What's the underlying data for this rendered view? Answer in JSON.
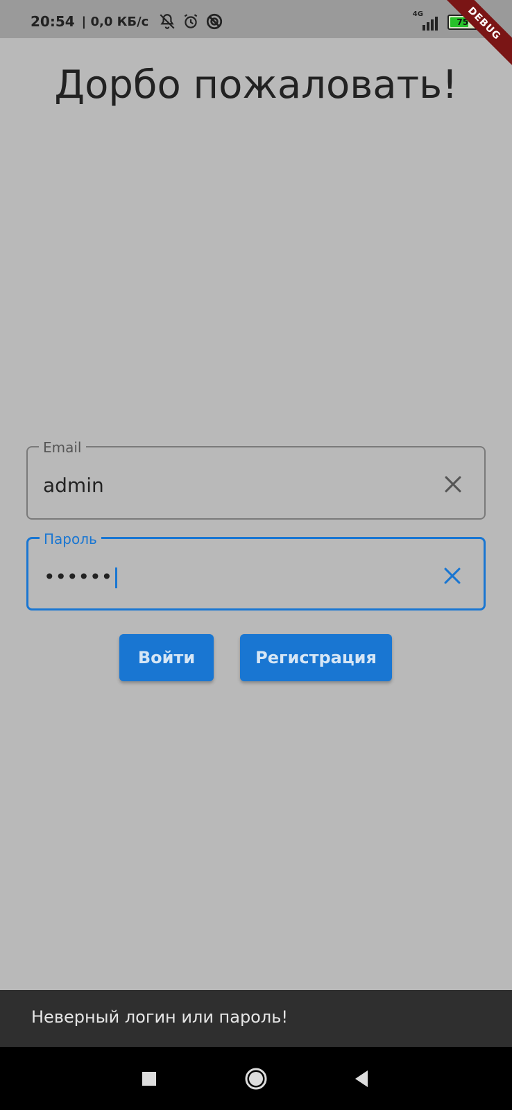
{
  "status_bar": {
    "time": "20:54",
    "network_speed": "| 0,0 КБ/с",
    "network_type": "4G",
    "battery_level": "75",
    "battery_fraction": 0.75
  },
  "debug_banner": "DEBUG",
  "title": "Дорбо пожаловать!",
  "email_field": {
    "label": "Email",
    "value": "admin",
    "clear_icon": "close-icon"
  },
  "password_field": {
    "label": "Пароль",
    "value": "••••••",
    "clear_icon": "close-icon"
  },
  "buttons": {
    "login": "Войти",
    "register": "Регистрация"
  },
  "snackbar": {
    "message": "Неверный логин или пароль!"
  },
  "navigation": {
    "recents": "recents-icon",
    "home": "home-icon",
    "back": "back-icon"
  },
  "colors": {
    "accent": "#1976d2",
    "background": "#b9b9b9",
    "snackbar": "#2f2f2f"
  }
}
